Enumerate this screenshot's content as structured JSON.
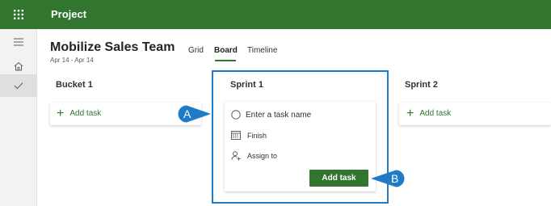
{
  "topbar": {
    "app_title": "Project",
    "waffle_icon": "waffle-icon",
    "bg_color": "#31752f"
  },
  "rail": {
    "items": [
      {
        "icon": "hamburger-icon"
      },
      {
        "icon": "home-icon"
      },
      {
        "icon": "checkmark-icon"
      }
    ]
  },
  "plan": {
    "title": "Mobilize Sales Team",
    "dates": "Apr 14 - Apr 14"
  },
  "views": [
    {
      "label": "Grid",
      "active": false
    },
    {
      "label": "Board",
      "active": true
    },
    {
      "label": "Timeline",
      "active": false
    }
  ],
  "columns": [
    {
      "title": "Bucket 1",
      "add_label": "Add task"
    },
    {
      "title": "Sprint 1"
    },
    {
      "title": "Sprint 2",
      "add_label": "Add task"
    }
  ],
  "task_form": {
    "name_placeholder": "Enter a task name",
    "finish_label": "Finish",
    "assign_label": "Assign to",
    "add_button": "Add task"
  },
  "callouts": {
    "a": "A",
    "b": "B",
    "color": "#1f7bc6"
  },
  "accent_color": "#31752f"
}
